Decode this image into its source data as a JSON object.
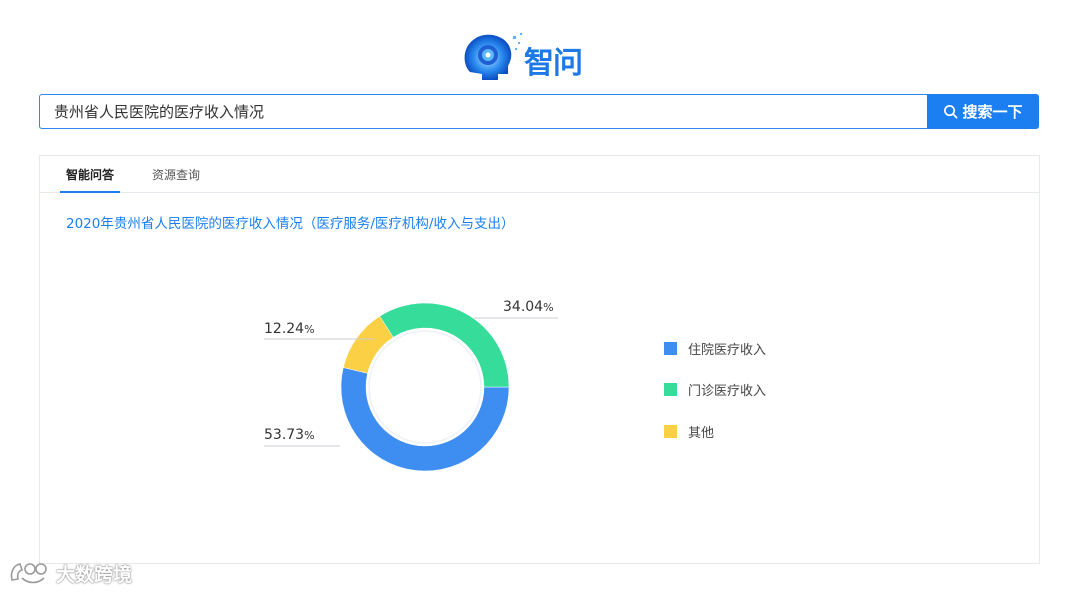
{
  "logo": {
    "text": "智问"
  },
  "search": {
    "value": "贵州省人民医院的医疗收入情况",
    "button_label": "搜索一下"
  },
  "tabs": [
    {
      "label": "智能问答",
      "active": true
    },
    {
      "label": "资源查询",
      "active": false
    }
  ],
  "result": {
    "title": "2020年贵州省人民医院的医疗收入情况（医疗服务/医疗机构/收入与支出）"
  },
  "chart_data": {
    "type": "pie",
    "series": [
      {
        "name": "住院医疗收入",
        "value": 53.73,
        "label": "53.73",
        "color": "#3d8ef0"
      },
      {
        "name": "门诊医疗收入",
        "value": 34.04,
        "label": "34.04",
        "color": "#35dc9a"
      },
      {
        "name": "其他",
        "value": 12.24,
        "label": "12.24",
        "color": "#fcd045"
      }
    ],
    "unit": "%",
    "legend_position": "right"
  },
  "watermark": {
    "text": "大数跨境"
  }
}
